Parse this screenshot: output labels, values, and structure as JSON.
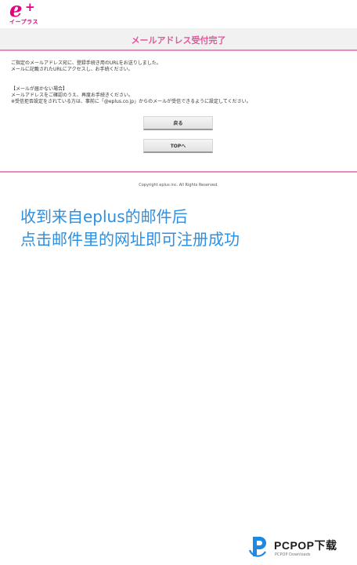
{
  "header": {
    "logo_mark": "e",
    "logo_plus": "+",
    "logo_sub": "イープラス",
    "brand_color": "#e4007f"
  },
  "title": "メールアドレス受付完了",
  "message": {
    "line1": "ご指定のメールアドレス宛に、登録手続き用のURLをお送りしました。",
    "line2": "メールに記載されたURLにアクセスし、お手続ください。",
    "notice_heading": "【メールが届かない場合】",
    "notice_line1": "メールアドレスをご確認のうえ、再度お手続きください。",
    "notice_line2": "※受信拒否設定をされている方は、事前に「@eplus.co.jp」からのメールが受信できるように設定してください。"
  },
  "buttons": {
    "back_label": "戻る",
    "top_label": "TOPへ"
  },
  "footer": {
    "copyright": "Copyright eplus inc. All Rights Reserved."
  },
  "annotation": {
    "line1": "收到来自eplus的邮件后",
    "line2": "点击邮件里的网址即可注册成功",
    "color": "#2f8fe0"
  },
  "watermark": {
    "text": "PCPOP下载",
    "sub": "PCPOP Downloads"
  }
}
